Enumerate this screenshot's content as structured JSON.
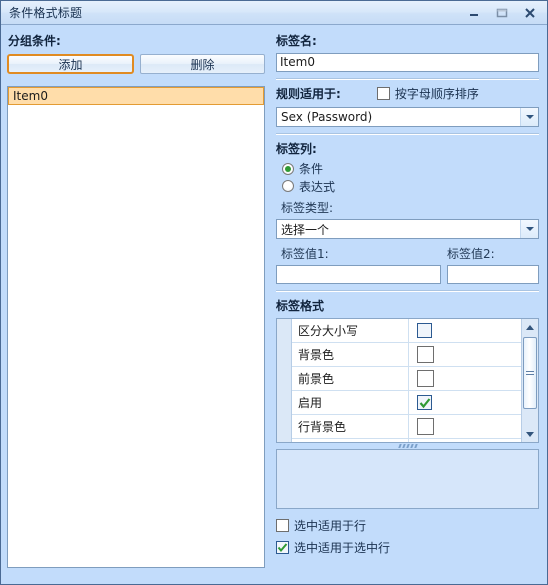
{
  "window": {
    "title": "条件格式标题",
    "buttons": {
      "minimize": "minimize",
      "maximize": "maximize",
      "close": "close"
    }
  },
  "left_panel": {
    "heading": "分组条件:",
    "add_button": "添加",
    "delete_button": "删除",
    "list_items": [
      {
        "label": "Item0",
        "selected": true
      }
    ]
  },
  "right_panel": {
    "label_name": {
      "heading": "标签名:",
      "value": "Item0"
    },
    "rules_apply": {
      "heading": "规则适用于:",
      "sort_checkbox_label": "按字母顺序排序",
      "sort_checkbox_checked": false,
      "combo_value": "Sex (Password)"
    },
    "label_column": {
      "heading": "标签列:",
      "radios": [
        {
          "label": "条件",
          "checked": true
        },
        {
          "label": "表达式",
          "checked": false
        }
      ],
      "type_label": "标签类型:",
      "type_value": "选择一个",
      "value1_label": "标签值1:",
      "value1": "",
      "value2_label": "标签值2:",
      "value2": ""
    },
    "label_format": {
      "heading": "标签格式",
      "rows": [
        {
          "name": "区分大小写",
          "kind": "checkbox",
          "checked": false,
          "focused": true
        },
        {
          "name": "背景色",
          "kind": "color",
          "checked": false,
          "focused": false
        },
        {
          "name": "前景色",
          "kind": "color",
          "checked": false,
          "focused": false
        },
        {
          "name": "启用",
          "kind": "checkbox",
          "checked": true,
          "focused": false
        },
        {
          "name": "行背景色",
          "kind": "color",
          "checked": false,
          "focused": false
        }
      ],
      "scrollbar": {
        "up_arrow": "scroll-up",
        "down_arrow": "scroll-down"
      }
    },
    "bottom_options": [
      {
        "label": "选中适用于行",
        "checked": false
      },
      {
        "label": "选中适用于选中行",
        "checked": true
      }
    ]
  },
  "colors": {
    "window_background": "#c2dcfb",
    "selection_orange": "#ffddaa",
    "selection_border": "#e39b33",
    "focus_border": "#e08b22",
    "radio_dot_green": "#2f9a34",
    "check_green": "#2f9a34",
    "border_blue": "#7f9dbe"
  }
}
